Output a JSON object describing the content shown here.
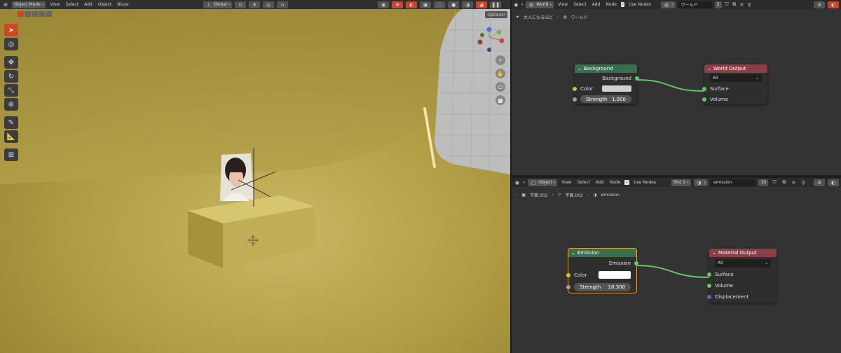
{
  "viewport": {
    "mode": "Object Mode",
    "menus": [
      "View",
      "Select",
      "Add",
      "Object",
      "Blaze"
    ],
    "orientation": "Global",
    "options_label": "Options",
    "gizmo_axes": [
      "Y",
      "X",
      "Z"
    ],
    "colors": {
      "floor": "#b9a54b",
      "accent": "#d0481f"
    }
  },
  "world_editor": {
    "editor_type": "World",
    "menus": [
      "View",
      "Select",
      "Add",
      "Node"
    ],
    "use_nodes_label": "Use Nodes",
    "world_name": "ワールド",
    "user_count": "2",
    "breadcrumb": [
      "大人になるほど",
      "ワールド"
    ],
    "background_node": {
      "title": "Background",
      "output_label": "Background",
      "color_label": "Color",
      "strength_label": "Strength",
      "strength_value": "1.000",
      "color": "#cfcfcf"
    },
    "output_node": {
      "title": "World Output",
      "target": "All",
      "inputs": [
        "Surface",
        "Volume"
      ]
    }
  },
  "material_editor": {
    "editor_type": "Object",
    "menus": [
      "View",
      "Select",
      "Add",
      "Node"
    ],
    "use_nodes_label": "Use Nodes",
    "slot": "Slot 1",
    "material_name": "emission",
    "user_count": "10",
    "breadcrumb": [
      "平面.002",
      "平面.002",
      "emission"
    ],
    "emission_node": {
      "title": "Emission",
      "output_label": "Emission",
      "color_label": "Color",
      "strength_label": "Strength",
      "strength_value": "18.300",
      "color": "#ffffff"
    },
    "output_node": {
      "title": "Material Output",
      "target": "All",
      "inputs": [
        "Surface",
        "Volume",
        "Displacement"
      ]
    }
  }
}
